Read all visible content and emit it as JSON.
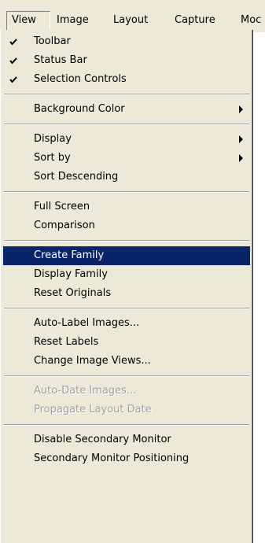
{
  "menubar": {
    "items": [
      "View",
      "Image",
      "Layout",
      "Capture",
      "Moc"
    ]
  },
  "view_menu": {
    "toolbar": "Toolbar",
    "status_bar": "Status Bar",
    "selection_controls": "Selection Controls",
    "background_color": "Background Color",
    "display": "Display",
    "sort_by": "Sort by",
    "sort_descending": "Sort Descending",
    "full_screen": "Full Screen",
    "comparison": "Comparison",
    "create_family": "Create Family",
    "display_family": "Display Family",
    "reset_originals": "Reset Originals",
    "auto_label_images": "Auto-Label Images...",
    "reset_labels": "Reset Labels",
    "change_image_views": "Change Image Views...",
    "auto_date_images": "Auto-Date Images...",
    "propagate_layout_date": "Propagate Layout Date",
    "disable_secondary_monitor": "Disable Secondary Monitor",
    "secondary_monitor_positioning": "Secondary Monitor Positioning"
  },
  "colors": {
    "menu_bg": "#ece9d8",
    "highlight_bg": "#0a246a",
    "highlight_text": "#ffffff",
    "disabled_text": "#a0a0a0"
  },
  "icons": {
    "check": "checkmark-icon",
    "submenu": "submenu-arrow-icon"
  }
}
